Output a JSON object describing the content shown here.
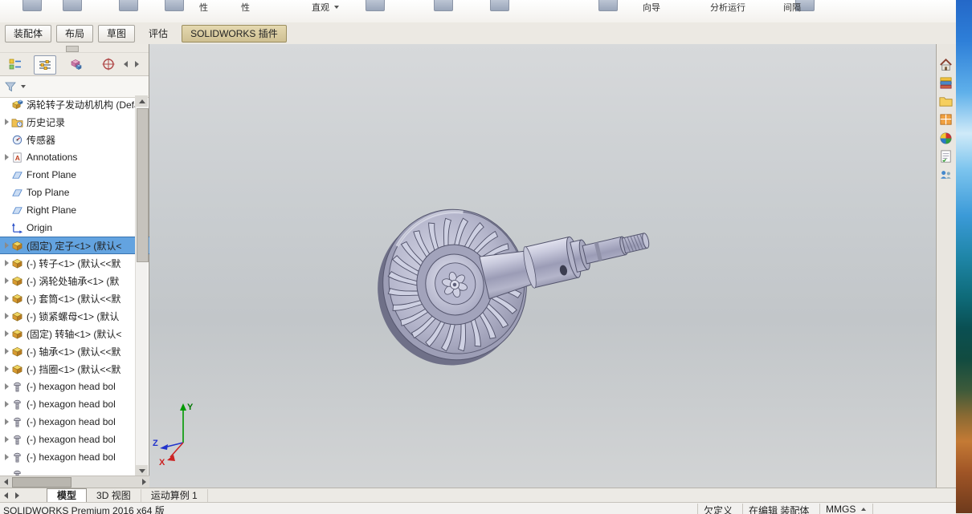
{
  "ribbon": {
    "fragments": [
      "性",
      "性",
      "直观",
      "分析运行",
      "向导",
      "间隔"
    ],
    "tabs": [
      "装配体",
      "布局",
      "草图",
      "评估",
      "SOLIDWORKS 插件"
    ]
  },
  "hud_icons": [
    "zoom-fit",
    "zoom-area",
    "previous-view",
    "section-view",
    "annotation-view",
    "view-orientation",
    "display-style",
    "hide-show-items",
    "edit-appearance",
    "apply-scene",
    "view-settings"
  ],
  "panel_tab_icons": [
    "featuremanager",
    "propertymanager",
    "configurationmanager",
    "dimxpert"
  ],
  "feature_panel": {
    "root_label": "涡轮转子发动机机构  (Defa",
    "items": [
      {
        "icon": "history-folder",
        "label": "历史记录"
      },
      {
        "icon": "sensors",
        "label": "传感器"
      },
      {
        "icon": "annotations",
        "label": "Annotations"
      },
      {
        "icon": "plane",
        "label": "Front Plane"
      },
      {
        "icon": "plane",
        "label": "Top Plane"
      },
      {
        "icon": "plane",
        "label": "Right Plane"
      },
      {
        "icon": "origin",
        "label": "Origin"
      },
      {
        "icon": "component",
        "label": "(固定) 定子<1> (默认<",
        "selected": true
      },
      {
        "icon": "component",
        "label": "(-) 转子<1> (默认<<默"
      },
      {
        "icon": "component",
        "label": "(-) 涡轮处轴承<1> (默"
      },
      {
        "icon": "component",
        "label": "(-) 套筒<1> (默认<<默"
      },
      {
        "icon": "component",
        "label": "(-) 锁紧螺母<1> (默认"
      },
      {
        "icon": "component",
        "label": "(固定) 转轴<1> (默认<"
      },
      {
        "icon": "component",
        "label": "(-) 轴承<1> (默认<<默"
      },
      {
        "icon": "component",
        "label": "(-) 挡圈<1> (默认<<默"
      },
      {
        "icon": "bolt",
        "label": "(-) hexagon head bol"
      },
      {
        "icon": "bolt",
        "label": "(-) hexagon head bol"
      },
      {
        "icon": "bolt",
        "label": "(-) hexagon head bol"
      },
      {
        "icon": "bolt",
        "label": "(-) hexagon head bol"
      },
      {
        "icon": "bolt",
        "label": "(-) hexagon head bol"
      }
    ]
  },
  "viewport": {
    "triad": {
      "x": "X",
      "y": "Y",
      "z": "Z"
    }
  },
  "task_pane_icons": [
    "home",
    "design-library",
    "file-explorer",
    "view-palette",
    "appearances",
    "custom-properties",
    "forum"
  ],
  "bottom_tabs": [
    "模型",
    "3D 视图",
    "运动算例 1"
  ],
  "status_bar": {
    "app_version": "SOLIDWORKS Premium 2016 x64 版",
    "constraint_state": "欠定义",
    "editing_state": "在编辑 装配体",
    "units": "MMGS"
  },
  "window_controls": {
    "close": "×"
  }
}
